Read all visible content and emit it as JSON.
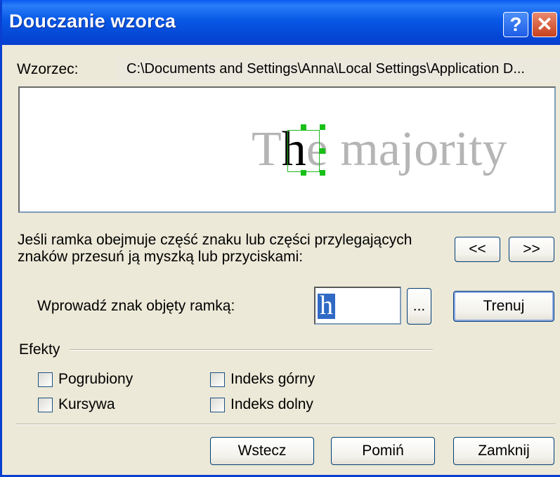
{
  "window": {
    "title": "Douczanie wzorca",
    "help_glyph": "?",
    "close_glyph": "✕"
  },
  "pattern": {
    "label": "Wzorzec:",
    "path": "C:\\Documents and Settings\\Anna\\Local Settings\\Application D..."
  },
  "preview": {
    "text_before": "T",
    "text_selected": "h",
    "text_after": "e majority"
  },
  "instructions": {
    "line1": "Jeśli ramka obejmuje część znaku lub części przylegających",
    "line2": "znaków przesuń ją myszką lub przyciskami:",
    "prev_label": "<<",
    "next_label": ">>"
  },
  "entry": {
    "label": "Wprowadź znak objęty ramką:",
    "value": "h",
    "browse_label": "...",
    "train_label": "Trenuj"
  },
  "effects": {
    "group_label": "Efekty",
    "bold": "Pogrubiony",
    "italic": "Kursywa",
    "superscript": "Indeks górny",
    "subscript": "Indeks dolny"
  },
  "buttons": {
    "back": "Wstecz",
    "skip": "Pomiń",
    "close": "Zamknij"
  }
}
